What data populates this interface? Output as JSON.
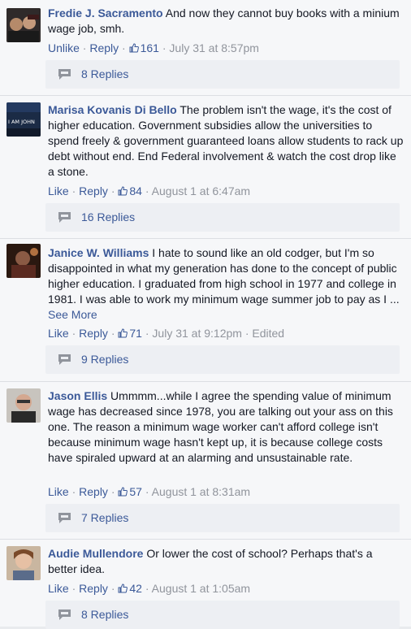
{
  "comments": [
    {
      "author": "Fredie J. Sacramento",
      "text": " And now they cannot buy books with a minium wage job, smh.",
      "see_more": "",
      "like_label": "Unlike",
      "reply_label": "Reply",
      "likes": "161",
      "timestamp": "July 31 at 8:57pm",
      "edited": "",
      "replies": "8 Replies"
    },
    {
      "author": "Marisa Kovanis Di Bello",
      "text": " The problem isn't the wage, it's the cost of higher education. Government subsidies allow the universities to spend freely & government guaranteed loans allow students to rack up debt without end. End Federal involvement & watch the cost drop like a stone.",
      "see_more": "",
      "like_label": "Like",
      "reply_label": "Reply",
      "likes": "84",
      "timestamp": "August 1 at 6:47am",
      "edited": "",
      "replies": "16 Replies",
      "avatar_text": "I AM JOHN"
    },
    {
      "author": "Janice W. Williams",
      "text": " I hate to sound like an old codger, but I'm so disappointed in what my generation has done to the concept of public higher education. I graduated from high school in 1977 and college in 1981. I was able to work my minimum wage summer job to pay as I ... ",
      "see_more": "See More",
      "like_label": "Like",
      "reply_label": "Reply",
      "likes": "71",
      "timestamp": "July 31 at 9:12pm",
      "edited": "Edited",
      "replies": "9 Replies"
    },
    {
      "author": "Jason Ellis",
      "text": " Ummmm...while I agree the spending value of minimum wage has decreased since 1978, you are talking out your ass on this one. The reason a minimum wage worker can't afford college isn't because minimum wage hasn't kept up, it is because college costs have spiraled upward at an alarming and unsustainable rate.",
      "see_more": "",
      "like_label": "Like",
      "reply_label": "Reply",
      "likes": "57",
      "timestamp": "August 1 at 8:31am",
      "edited": "",
      "replies": "7 Replies"
    },
    {
      "author": "Audie Mullendore",
      "text": " Or lower the cost of school? Perhaps that's a better idea.",
      "see_more": "",
      "like_label": "Like",
      "reply_label": "Reply",
      "likes": "42",
      "timestamp": "August 1 at 1:05am",
      "edited": "",
      "replies": "8 Replies"
    }
  ],
  "separator": "·",
  "colors": {
    "link": "#3b5998",
    "meta": "#90949c",
    "background": "#f6f7f9",
    "reply_box": "#edeff3"
  }
}
